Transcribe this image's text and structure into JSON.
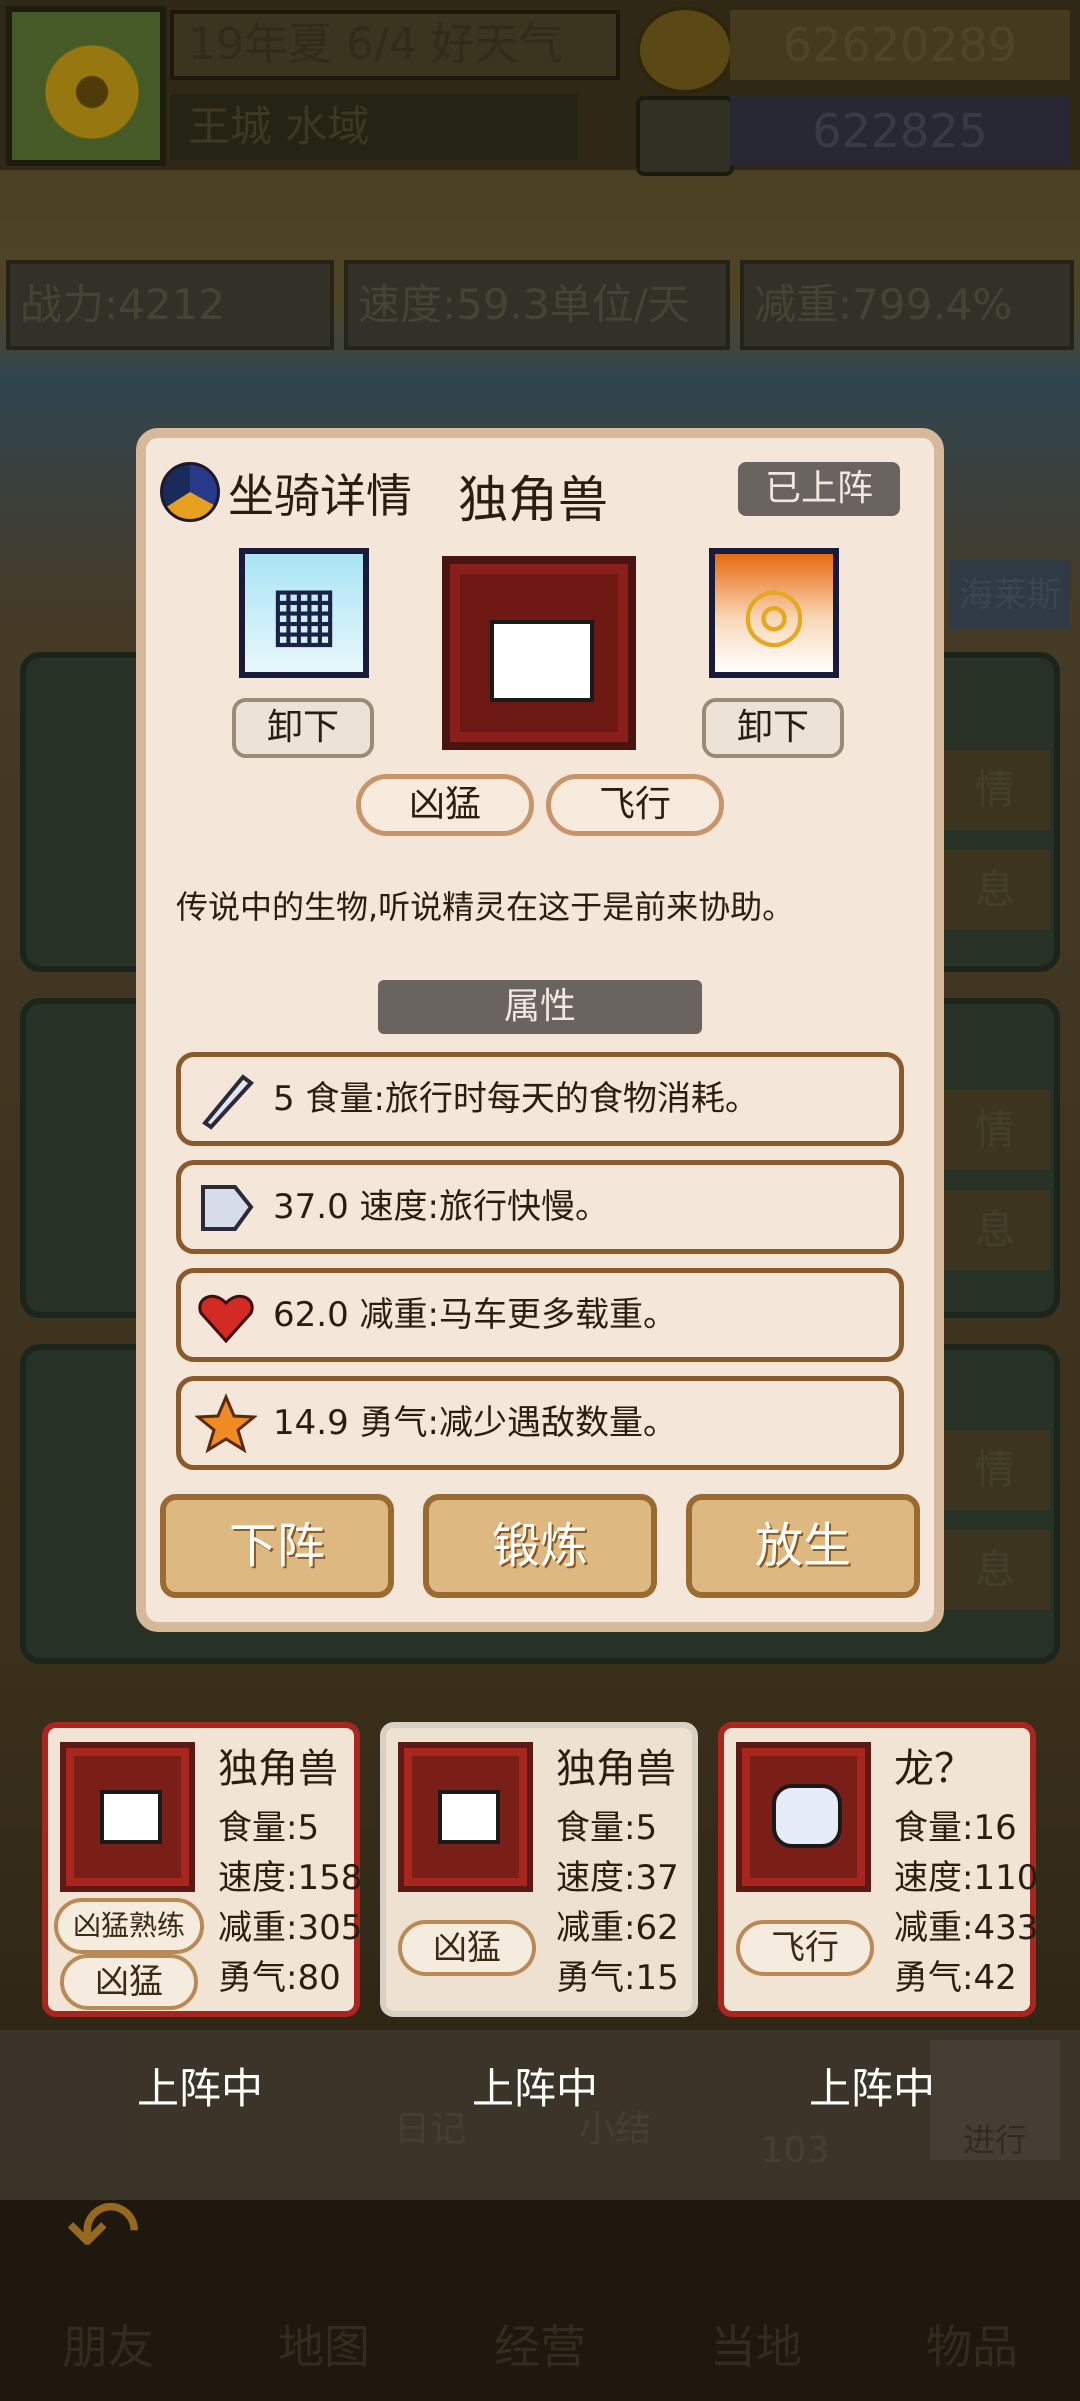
{
  "header": {
    "date": "19年夏 6/4 好天气",
    "location": "王城 水域",
    "money": "62620289",
    "gems": "622825"
  },
  "stats_bar": {
    "power": "战力:4212",
    "speed": "速度:59.3单位/天",
    "weight": "减重:799.4%"
  },
  "side_labels": {
    "hero_name": "海莱斯",
    "detail": "情",
    "rest": "息"
  },
  "modal": {
    "title": "坐骑详情",
    "mount_name": "独角兽",
    "status": "已上阵",
    "unload_left": "卸下",
    "unload_right": "卸下",
    "traits": [
      "凶猛",
      "飞行"
    ],
    "description": "传说中的生物,听说精灵在这于是前来协助。",
    "section_title": "属性",
    "attributes": [
      {
        "icon": "feather-icon",
        "text": "5 食量:旅行时每天的食物消耗。"
      },
      {
        "icon": "wing-icon",
        "text": "37.0 速度:旅行快慢。"
      },
      {
        "icon": "heart-icon",
        "text": "62.0 减重:马车更多载重。"
      },
      {
        "icon": "star-icon",
        "text": "14.9 勇气:减少遇敌数量。"
      }
    ],
    "actions": [
      "下阵",
      "锻炼",
      "放生"
    ]
  },
  "mounts": [
    {
      "name": "独角兽",
      "food": "食量:5",
      "speed": "速度:158",
      "weight": "减重:305",
      "courage": "勇气:80",
      "tags": [
        "凶猛熟练",
        "凶猛"
      ],
      "status": "上阵中"
    },
    {
      "name": "独角兽",
      "food": "食量:5",
      "speed": "速度:37",
      "weight": "减重:62",
      "courage": "勇气:15",
      "tags": [
        "凶猛"
      ],
      "status": "上阵中"
    },
    {
      "name": "龙？",
      "food": "食量:16",
      "speed": "速度:110",
      "weight": "减重:433",
      "courage": "勇气:42",
      "tags": [
        "飞行"
      ],
      "status": "上阵中"
    }
  ],
  "mid_bar": {
    "diary": "日记",
    "summary": "小结",
    "proceed": "进行",
    "count": "103"
  },
  "nav": [
    "朋友",
    "地图",
    "经营",
    "当地",
    "物品"
  ],
  "colors": {
    "modal_bg": "#f4e6d8",
    "accent_red": "#a9261e",
    "button_tan": "#ddb880"
  }
}
